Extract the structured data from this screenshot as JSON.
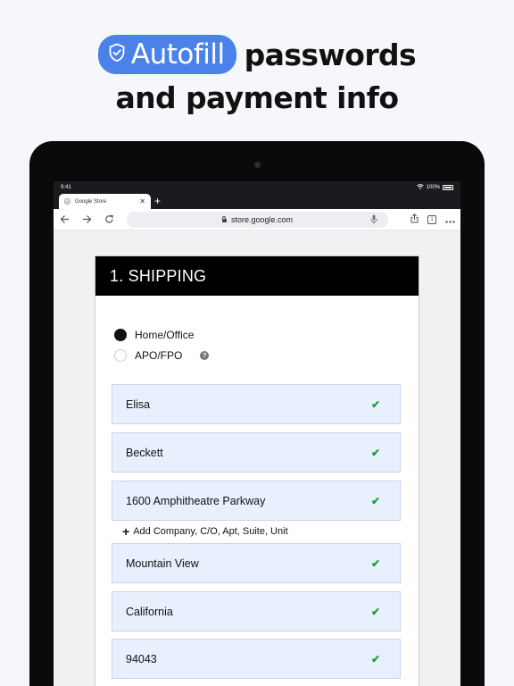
{
  "headline": {
    "badge_icon": "shield-check-icon",
    "badge_label": "Autofill",
    "line1_rest": "passwords",
    "line2": "and payment info",
    "badge_color": "#4a82ea"
  },
  "status_bar": {
    "time": "9:41",
    "battery": "100%"
  },
  "browser": {
    "tab_title": "Google Store",
    "tab_favicon": "G",
    "url": "store.google.com",
    "tab_count": "1"
  },
  "form": {
    "section_title": "1. SHIPPING",
    "delivery_options": [
      {
        "label": "Home/Office",
        "selected": true
      },
      {
        "label": "APO/FPO",
        "selected": false
      }
    ],
    "help_glyph": "?",
    "fields": [
      {
        "value": "Elisa",
        "autofilled": true
      },
      {
        "value": "Beckett",
        "autofilled": true
      },
      {
        "value": "1600 Amphitheatre Parkway",
        "autofilled": true
      },
      {
        "value": "Mountain View",
        "autofilled": true
      },
      {
        "value": "California",
        "autofilled": true
      },
      {
        "value": "94043",
        "autofilled": true
      }
    ],
    "add_line_label": "Add Company, C/O, Apt, Suite, Unit",
    "autofill_fill_color": "#e8f0fe",
    "check_color": "#1e9e3a"
  }
}
